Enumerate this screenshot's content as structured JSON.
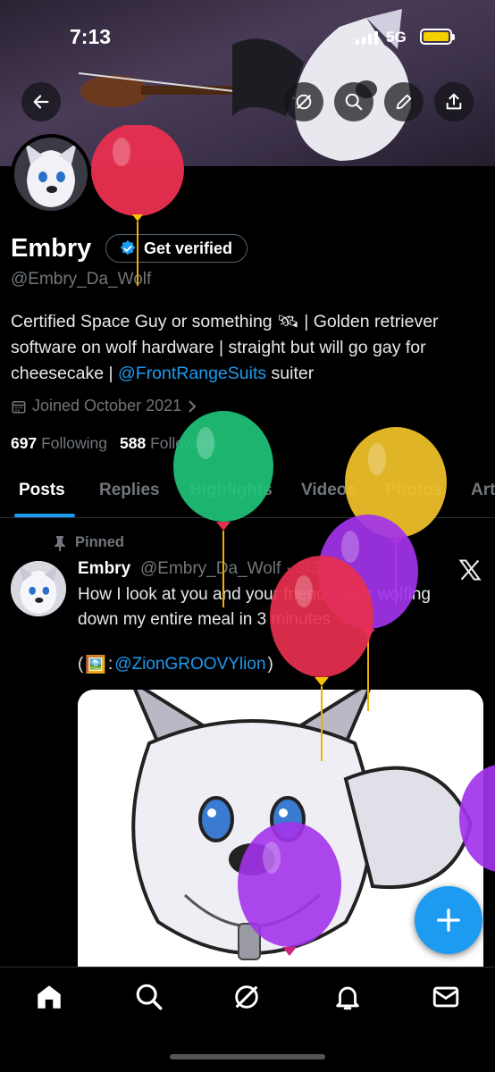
{
  "status_bar": {
    "time": "7:13",
    "network": "5G",
    "battery_color": "#f5d000"
  },
  "header": {
    "back_icon": "arrow-left-icon",
    "actions": [
      "grok-icon",
      "search-icon",
      "edit-icon",
      "share-icon"
    ]
  },
  "profile": {
    "name": "Embry",
    "verify_label": "Get verified",
    "handle": "@Embry_Da_Wolf",
    "bio_part1": "Certified Space Guy or something 🛰 | Golden retriever software on wolf hardware | straight but will go gay for cheesecake | ",
    "bio_link": "@FrontRangeSuits",
    "bio_part2": " suiter",
    "joined": "Joined October 2021",
    "following_count": "697",
    "following_label": "Following",
    "followers_count": "588",
    "followers_label": "Followers"
  },
  "tabs": [
    "Posts",
    "Replies",
    "Highlights",
    "Videos",
    "Photos",
    "Art"
  ],
  "active_tab": "Posts",
  "pinned_tweet": {
    "pinned_label": "Pinned",
    "name": "Embry",
    "handle": "@Embry_Da_Wolf · 3/31",
    "text": "How I look at you and your friends after wolfing down my entire meal in 3 minutes",
    "credit_open": "(",
    "credit_emoji": "🖼️",
    "credit_sep": ": ",
    "credit_link": "@ZionGROOVYlion",
    "credit_close": " )"
  },
  "bottom_nav": [
    "home-icon",
    "search-icon",
    "grok-icon",
    "notifications-icon",
    "messages-icon"
  ],
  "colors": {
    "accent": "#1d9bf0",
    "background": "#000000",
    "muted": "#71767b"
  },
  "balloons": [
    "red",
    "green",
    "yellow",
    "purple",
    "red",
    "purple",
    "purple"
  ]
}
